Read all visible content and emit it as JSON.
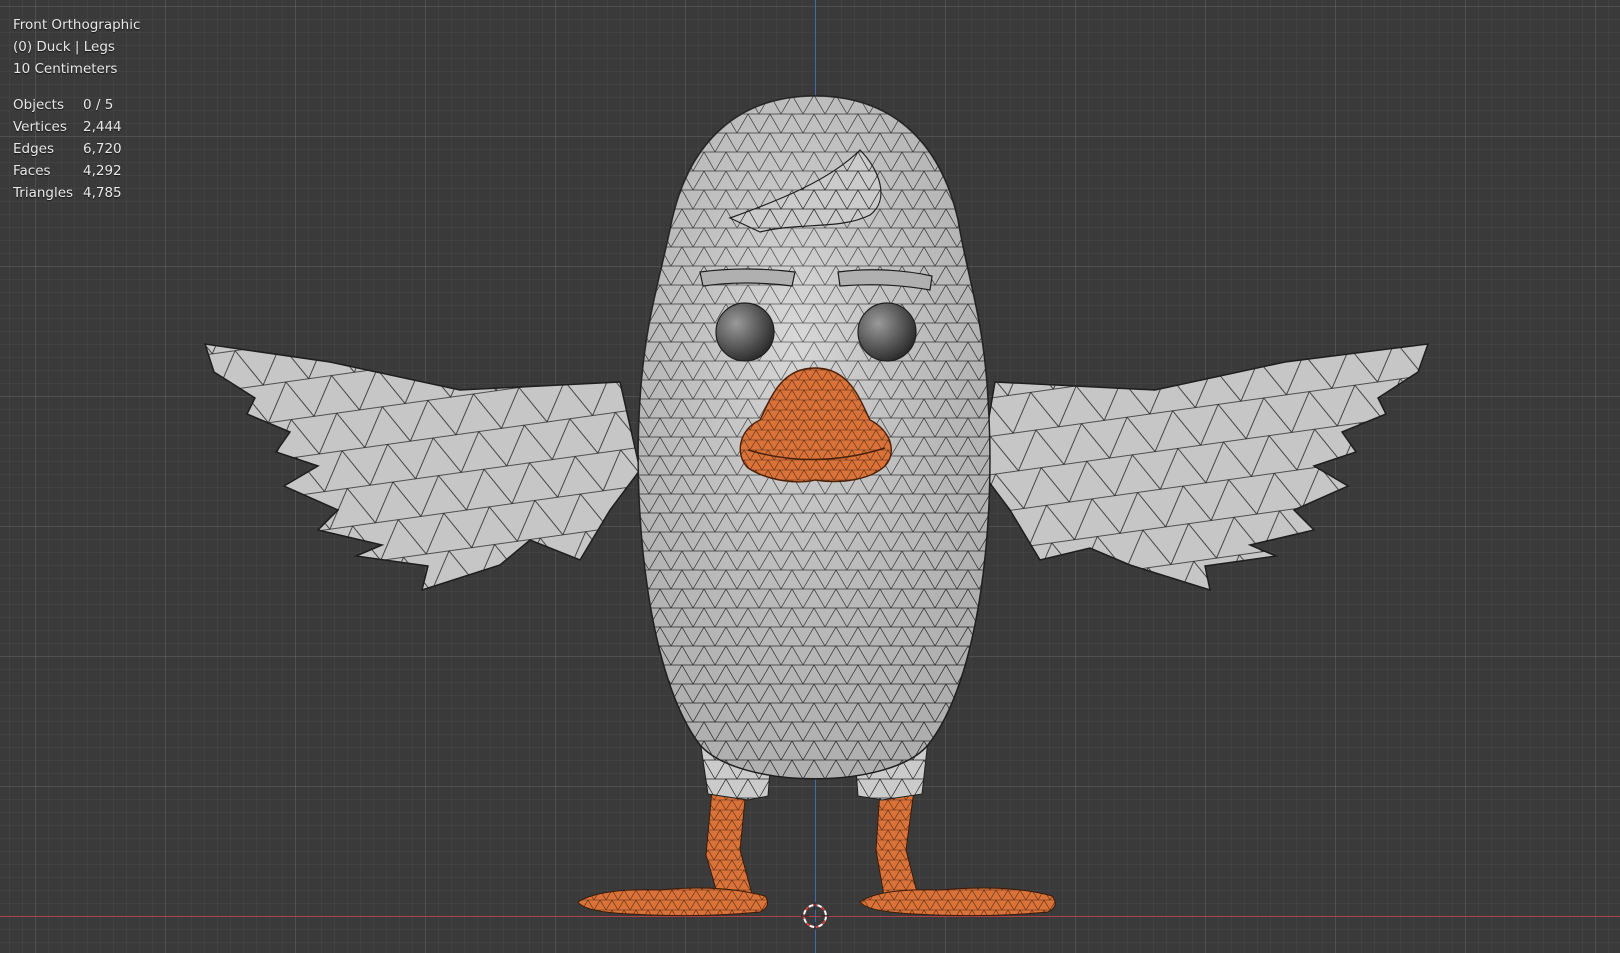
{
  "viewport": {
    "view_name": "Front Orthographic",
    "collection_info": "(0) Duck | Legs",
    "grid_scale": "10 Centimeters"
  },
  "stats": [
    {
      "label": "Objects",
      "value": "0 / 5"
    },
    {
      "label": "Vertices",
      "value": "2,444"
    },
    {
      "label": "Edges",
      "value": "6,720"
    },
    {
      "label": "Faces",
      "value": "4,292"
    },
    {
      "label": "Triangles",
      "value": "4,785"
    }
  ],
  "colors": {
    "background": "#3a3a3a",
    "body": "#c9c9c9",
    "beak": "#d9733a",
    "wire": "#1e1e1e",
    "x_axis": "#b5414c",
    "y_axis": "#3f6fbf"
  }
}
